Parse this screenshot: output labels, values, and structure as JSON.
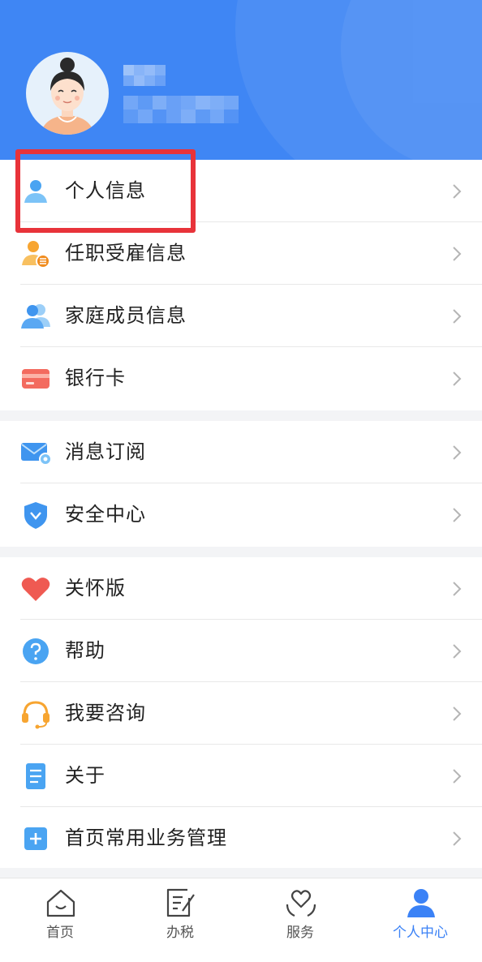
{
  "colors": {
    "header": "#3f86f4",
    "accent": "#3b82f6",
    "highlight": "#e8333a"
  },
  "user": {
    "name": "",
    "phone": ""
  },
  "menu_group1": [
    {
      "label": "个人信息",
      "icon": "person-icon"
    },
    {
      "label": "任职受雇信息",
      "icon": "employment-icon"
    },
    {
      "label": "家庭成员信息",
      "icon": "family-icon"
    },
    {
      "label": "银行卡",
      "icon": "bank-card-icon"
    }
  ],
  "menu_group2": [
    {
      "label": "消息订阅",
      "icon": "mail-settings-icon"
    },
    {
      "label": "安全中心",
      "icon": "shield-icon"
    }
  ],
  "menu_group3": [
    {
      "label": "关怀版",
      "icon": "heart-icon"
    },
    {
      "label": "帮助",
      "icon": "help-icon"
    },
    {
      "label": "我要咨询",
      "icon": "headset-icon"
    },
    {
      "label": "关于",
      "icon": "document-icon"
    },
    {
      "label": "首页常用业务管理",
      "icon": "plus-square-icon"
    }
  ],
  "tabbar": [
    {
      "label": "首页",
      "icon": "home-icon"
    },
    {
      "label": "办税",
      "icon": "tax-form-icon"
    },
    {
      "label": "服务",
      "icon": "service-heart-icon"
    },
    {
      "label": "个人中心",
      "icon": "person-icon",
      "active": true
    }
  ]
}
